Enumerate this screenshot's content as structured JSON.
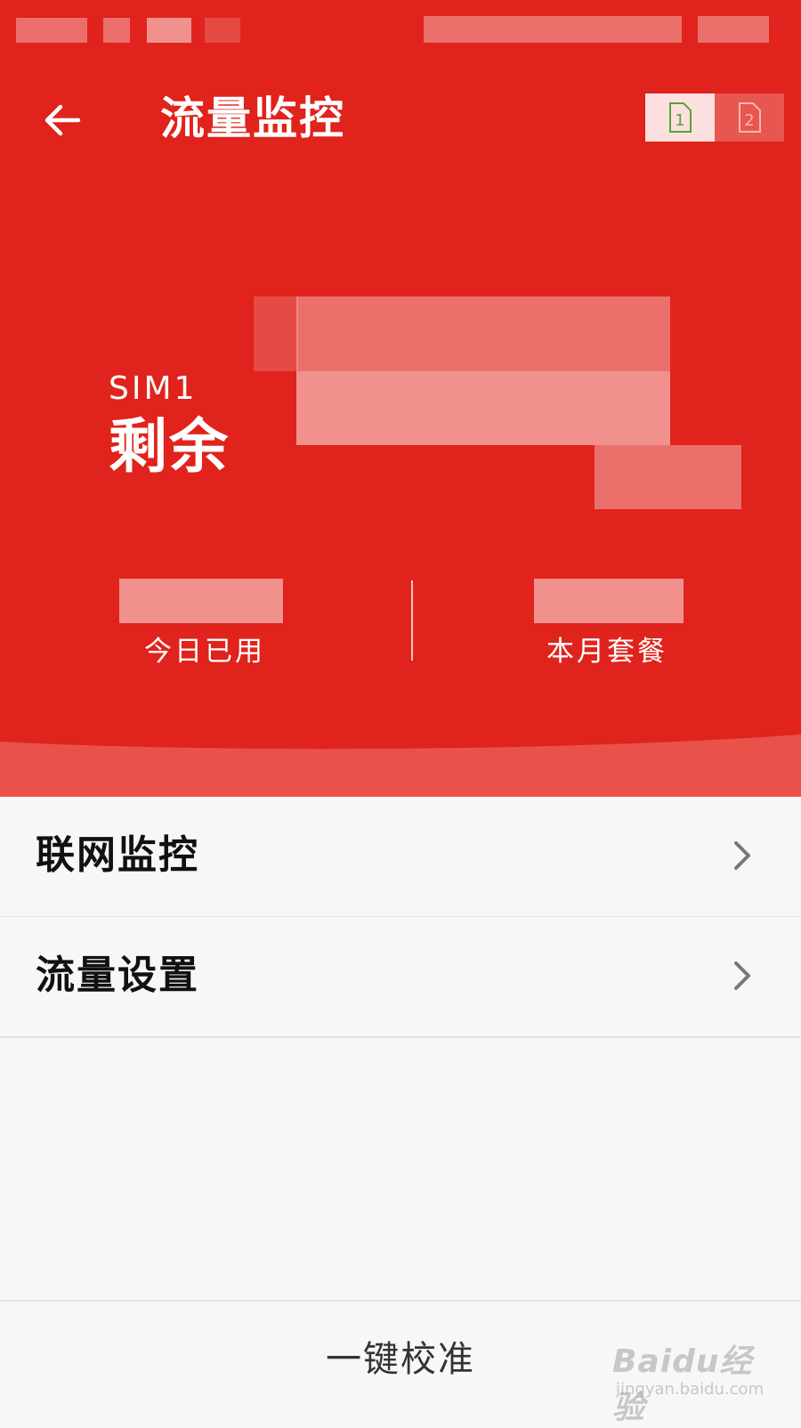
{
  "app": {
    "title": "流量监控"
  },
  "sim_switch": {
    "tabs": [
      {
        "label": "1",
        "active": true
      },
      {
        "label": "2",
        "active": false
      }
    ]
  },
  "summary": {
    "sim": "SIM1",
    "remaining_label": "剩余",
    "today_used_label": "今日已用",
    "monthly_plan_label": "本月套餐"
  },
  "menu": {
    "items": [
      {
        "label": "联网监控"
      },
      {
        "label": "流量设置"
      }
    ]
  },
  "actions": {
    "calibrate": "一键校准"
  },
  "watermark": {
    "logo": "Baidu经验",
    "url": "jingyan.baidu.com"
  },
  "colors": {
    "brand_red": "#e0231c",
    "background": "#f6f6f6"
  }
}
